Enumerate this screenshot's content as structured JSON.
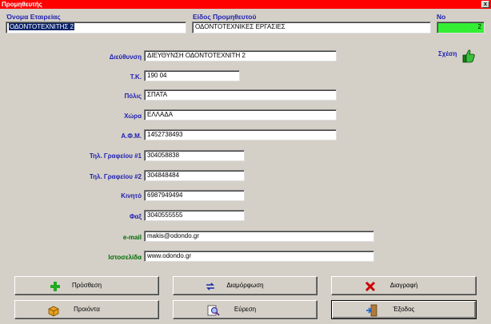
{
  "window": {
    "title": "Προμηθευτής",
    "close_glyph": "x"
  },
  "header": {
    "company_label": "Όνομα Εταιρείας",
    "company_value": "ΟΔΟΝΤΟΤΕΧΝΙΤΗΣ 2",
    "type_label": "Είδος Προμηθευτού",
    "type_value": "ΟΔΟΝΤΟΤΕΧΝΙΚΕΣ ΕΡΓΑΣΙΕΣ",
    "no_label": "Νο",
    "no_value": "2"
  },
  "relation": {
    "label": "Σχέση",
    "icon": "thumbs-up-icon"
  },
  "fields": {
    "address_label": "Διεύθυνση",
    "address_value": "ΔΙΕΥΘΥΝΣΗ ΟΔΟΝΤΟΤΕΧΝΙΤΗ 2",
    "zip_label": "Τ.Κ.",
    "zip_value": "190 04",
    "city_label": "Πόλις",
    "city_value": "ΣΠΑΤΑ",
    "country_label": "Χώρα",
    "country_value": "ΕΛΛΑΔΑ",
    "afm_label": "Α.Φ.Μ.",
    "afm_value": "1452738493",
    "phone1_label": "Τηλ. Γραφείου #1",
    "phone1_value": "304058838",
    "phone2_label": "Τηλ. Γραφείου #2",
    "phone2_value": "304848484",
    "mobile_label": "Κινητό",
    "mobile_value": "6987949494",
    "fax_label": "Φαξ",
    "fax_value": "3040555555",
    "email_label": "e-mail",
    "email_value": "makis@odondo.gr",
    "website_label": "Ιστοσελίδα",
    "website_value": "www.odondo.gr"
  },
  "buttons": {
    "add": "Πρόσθεση",
    "edit": "Διαμόρφωση",
    "delete": "Διαγραφή",
    "products": "Προιόντα",
    "find": "Εύρεση",
    "exit": "Έξοδος"
  },
  "colors": {
    "title_bar": "#ff0000",
    "label_blue": "#1f1fb0",
    "label_green": "#006b00",
    "no_field": "#33ee33"
  }
}
